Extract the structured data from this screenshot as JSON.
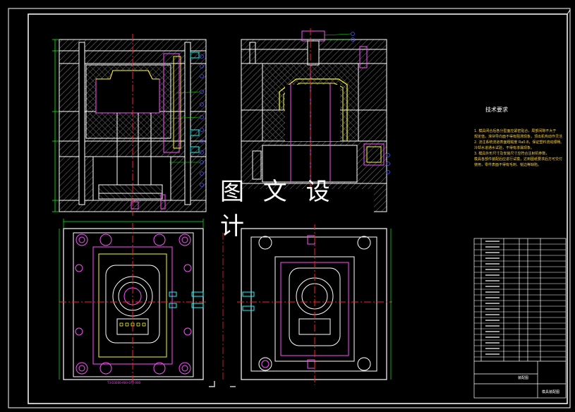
{
  "watermark": "图 文 设 计",
  "technical_requirements": {
    "title": "技术要求",
    "lines": [
      "1. 模具闭合后各分型面应紧密贴合，局部间隙不大于",
      "规定值，滑块导向面不得有阻滞现象，顶出机构动作灵活。",
      "2. 浇注系统流道表面粗糙度 Ra0.8，保证塑料流动顺畅。",
      "冷却水道通水试验，不得有渗漏现象。",
      "3. 模具外形尺寸及安装尺寸应符合注射机参数，",
      "模具各部件装配后应进行试模，达到图纸要求后方可交付",
      "使用，零件表面不得有毛刺、锐边等缺陷。"
    ]
  },
  "part_label": "T3-D3000-A00-072-000",
  "title_block": {
    "sheet_mark": "装配图",
    "drawing_name": "模具装配图"
  },
  "colors": {
    "frame": "#ffffff",
    "hatch": "#7f7f7f",
    "cavity": "#ffff00",
    "core": "#ff4cff",
    "cooling": "#00ffff",
    "balloon": "#4c4cff",
    "dimension": "#00ff00",
    "bolt": "#ff3030",
    "centerline": "#ff2020"
  }
}
